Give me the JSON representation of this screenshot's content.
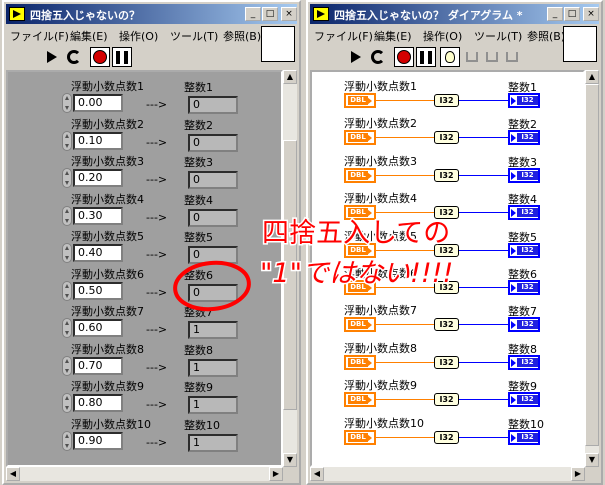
{
  "front_panel": {
    "title": "四捨五入じゃないの？",
    "window_buttons": [
      "_",
      "□",
      "×"
    ],
    "menu": [
      "ファイル(F)",
      "編集(E)",
      "操作(O)",
      "ツール(T)",
      "参照(B)"
    ],
    "rows": [
      {
        "control_label": "浮動小数点数1",
        "value": "0.00",
        "indicator_label": "整数1",
        "result": "0"
      },
      {
        "control_label": "浮動小数点数2",
        "value": "0.10",
        "indicator_label": "整数2",
        "result": "0"
      },
      {
        "control_label": "浮動小数点数3",
        "value": "0.20",
        "indicator_label": "整数3",
        "result": "0"
      },
      {
        "control_label": "浮動小数点数4",
        "value": "0.30",
        "indicator_label": "整数4",
        "result": "0"
      },
      {
        "control_label": "浮動小数点数5",
        "value": "0.40",
        "indicator_label": "整数5",
        "result": "0"
      },
      {
        "control_label": "浮動小数点数6",
        "value": "0.50",
        "indicator_label": "整数6",
        "result": "0"
      },
      {
        "control_label": "浮動小数点数7",
        "value": "0.60",
        "indicator_label": "整数7",
        "result": "1"
      },
      {
        "control_label": "浮動小数点数8",
        "value": "0.70",
        "indicator_label": "整数8",
        "result": "1"
      },
      {
        "control_label": "浮動小数点数9",
        "value": "0.80",
        "indicator_label": "整数9",
        "result": "1"
      },
      {
        "control_label": "浮動小数点数10",
        "value": "0.90",
        "indicator_label": "整数10",
        "result": "1"
      }
    ],
    "arrow_text": "--->"
  },
  "diagram": {
    "title": "四捨五入じゃないの？ ダイアグラム *",
    "window_buttons": [
      "_",
      "□",
      "×"
    ],
    "menu": [
      "ファイル(F)",
      "編集(E)",
      "操作(O)",
      "ツール(T)",
      "参照(B)"
    ],
    "dbl_tag": "DBL",
    "i32_tag": "I32",
    "conversion_tag": "I32",
    "control_labels": [
      "浮動小数点数1",
      "浮動小数点数2",
      "浮動小数点数3",
      "浮動小数点数4",
      "浮動小数点数5",
      "浮動小数点数6",
      "浮動小数点数7",
      "浮動小数点数8",
      "浮動小数点数9",
      "浮動小数点数10"
    ],
    "indicator_labels": [
      "整数1",
      "整数2",
      "整数3",
      "整数4",
      "整数5",
      "整数6",
      "整数7",
      "整数8",
      "整数9",
      "整数10"
    ]
  },
  "annotation": {
    "line1": "四捨五入しての",
    "line2": "\"1\"ではない!!!!",
    "color": "#ff0000"
  },
  "colors": {
    "title_bar": "#0a246a",
    "dbl_orange": "#ff8000",
    "i32_blue": "#0000ff",
    "panel_gray": "#9f9f9f",
    "stop_red": "#d40000"
  }
}
